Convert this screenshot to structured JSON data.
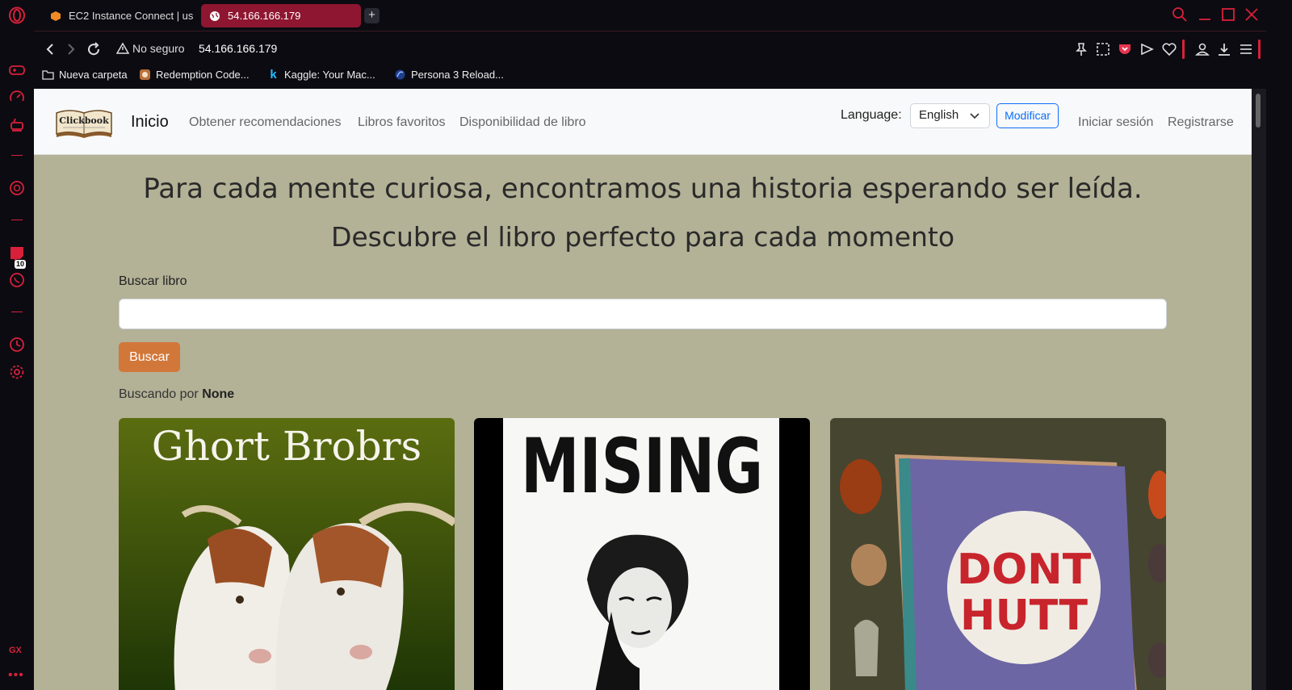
{
  "browser": {
    "tabs": [
      {
        "label": "EC2 Instance Connect | us",
        "active": false
      },
      {
        "label": "54.166.166.179",
        "active": true
      }
    ],
    "security_label": "No seguro",
    "url": "54.166.166.179",
    "bookmarks": [
      {
        "label": "Nueva carpeta"
      },
      {
        "label": "Redemption Code..."
      },
      {
        "label": "Kaggle: Your Mac..."
      },
      {
        "label": "Persona 3 Reload..."
      }
    ],
    "sidebar_badge": "10",
    "sidebar_gx_label": "GX",
    "accent_color": "#d8203a"
  },
  "site": {
    "nav": {
      "brand": "Inicio",
      "logo_text": "Clickbook",
      "links": [
        "Obtener recomendaciones",
        "Libros favoritos",
        "Disponibilidad de libro"
      ],
      "language_label": "Language:",
      "language_selected": "English",
      "modify_button": "Modificar",
      "login": "Iniciar sesión",
      "register": "Registrarse"
    },
    "hero": {
      "line1": "Para cada mente curiosa, encontramos una historia esperando ser leída.",
      "line2": "Descubre el libro perfecto para cada momento"
    },
    "search": {
      "label": "Buscar libro",
      "value": "",
      "button": "Buscar",
      "status_prefix": "Buscando por",
      "status_term": "None"
    },
    "books": [
      {
        "cover_text": "Ghort Brobrs"
      },
      {
        "cover_text": "MISING"
      },
      {
        "cover_text_line1": "DONT",
        "cover_text_line2": "HUTT"
      }
    ],
    "colors": {
      "page_bg": "#b3b196",
      "search_button": "#d2773a",
      "primary": "#0d6efd"
    }
  }
}
